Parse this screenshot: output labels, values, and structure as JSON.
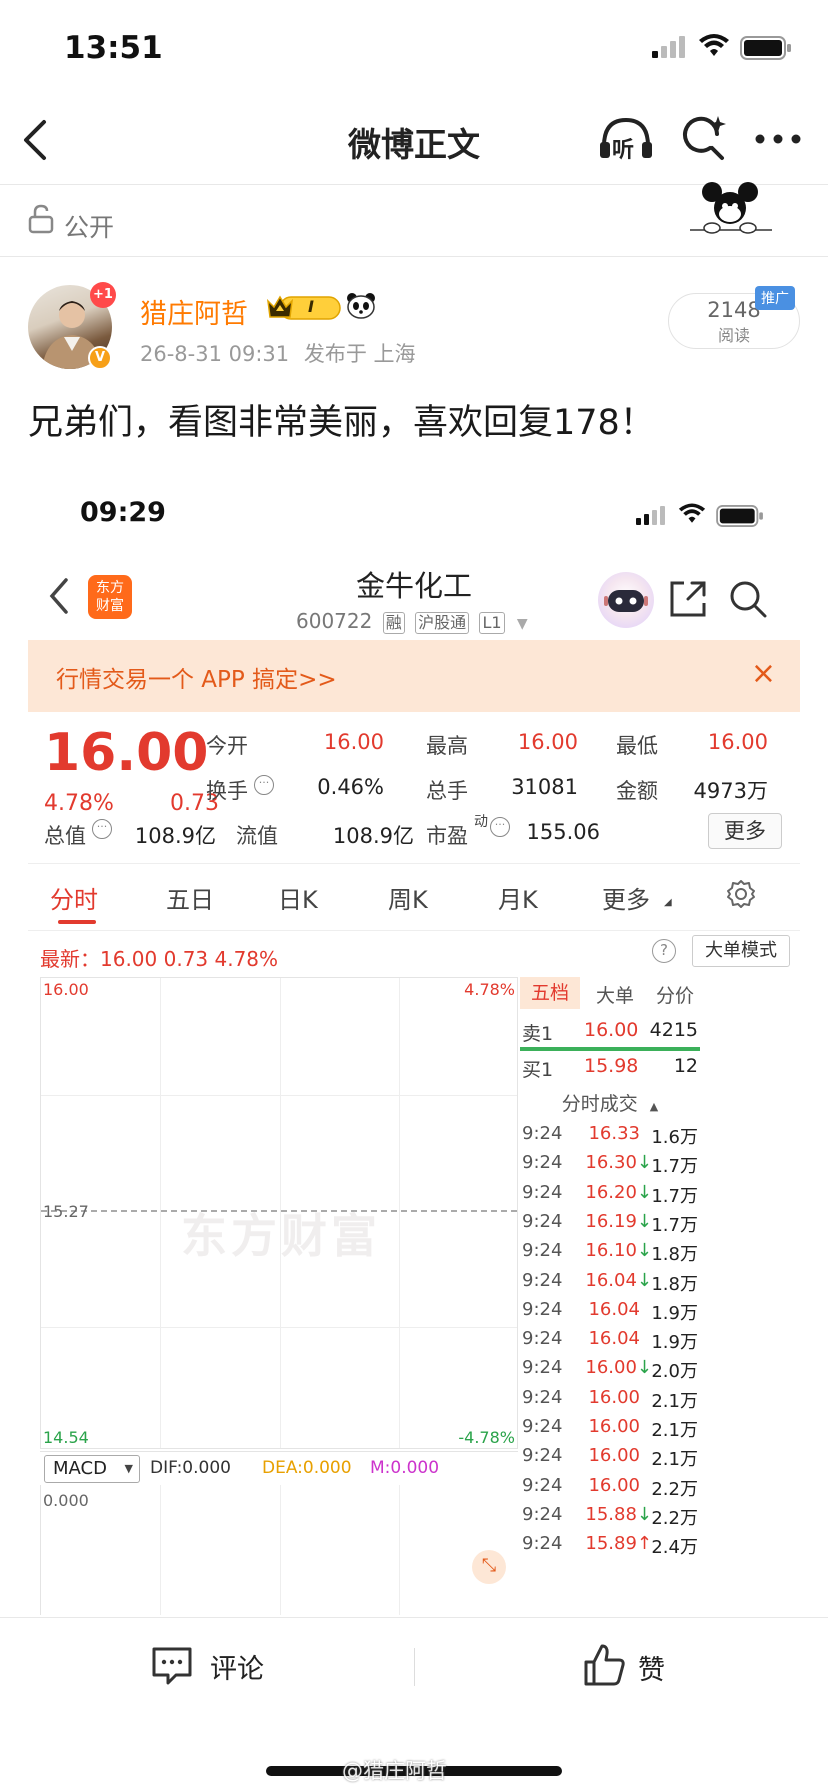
{
  "status_bar": {
    "time": "13:51"
  },
  "nav": {
    "title": "微博正文",
    "listen_label": "听"
  },
  "visibility": {
    "label": "公开"
  },
  "post": {
    "author": "猎庄阿哲",
    "avatar_badge": "+1",
    "level_badge": "I",
    "date": "26-8-31 09:31",
    "location_text": "发布于 上海",
    "read_count": "2148",
    "read_label": "阅读",
    "promo_tag": "推广",
    "text": "兄弟们，看图非常美丽，喜欢回复178！"
  },
  "screenshot": {
    "time": "09:29",
    "logo_text": [
      "东方",
      "财富"
    ],
    "stock_name": "金牛化工",
    "stock_code": "600722",
    "stock_tags": [
      "融",
      "沪股通",
      "L1"
    ],
    "banner_text": "行情交易一个 APP 搞定>>",
    "banner_close": "×",
    "price": "16.00",
    "change_pct": "4.78%",
    "change_abs": "0.73",
    "stats": [
      {
        "label": "今开",
        "value": "16.00",
        "color": "red"
      },
      {
        "label": "最高",
        "value": "16.00",
        "color": "red"
      },
      {
        "label": "最低",
        "value": "16.00",
        "color": "red"
      },
      {
        "label": "换手",
        "value": "0.46%",
        "color": "dark"
      },
      {
        "label": "总手",
        "value": "31081",
        "color": "dark"
      },
      {
        "label": "金额",
        "value": "4973万",
        "color": "dark"
      },
      {
        "label": "总值",
        "value": "108.9亿",
        "color": "dark"
      },
      {
        "label": "流值",
        "value": "108.9亿",
        "color": "dark"
      },
      {
        "label": "市盈",
        "value": "155.06",
        "color": "dark"
      }
    ],
    "pe_superscript": "动",
    "more_button": "更多",
    "tabs": [
      "分时",
      "五日",
      "日K",
      "周K",
      "月K",
      "更多"
    ],
    "latest_line": "最新：16.00  0.73  4.78%",
    "big_mode": "大单模式",
    "help": "?",
    "chart_labels": {
      "top_left": "16.00",
      "top_right": "4.78%",
      "mid": "15.27",
      "bottom_left": "14.54",
      "bottom_right": "-4.78%",
      "watermark": "东方财富"
    },
    "macd": {
      "select": "MACD",
      "dif": "DIF:0.000",
      "dea": "DEA:0.000",
      "m": "M:0.000",
      "zero": "0.000"
    },
    "right_panel": {
      "tabs": [
        "五档",
        "大单",
        "分价"
      ],
      "sell1": {
        "label": "卖1",
        "price": "16.00",
        "vol": "4215"
      },
      "buy1": {
        "label": "买1",
        "price": "15.98",
        "vol": "12"
      },
      "trades_header": "分时成交",
      "trades": [
        {
          "t": "9:24",
          "p": "16.33",
          "arrow": "",
          "v": "1.6万"
        },
        {
          "t": "9:24",
          "p": "16.30",
          "arrow": "down",
          "v": "1.7万"
        },
        {
          "t": "9:24",
          "p": "16.20",
          "arrow": "down",
          "v": "1.7万"
        },
        {
          "t": "9:24",
          "p": "16.19",
          "arrow": "down",
          "v": "1.7万"
        },
        {
          "t": "9:24",
          "p": "16.10",
          "arrow": "down",
          "v": "1.8万"
        },
        {
          "t": "9:24",
          "p": "16.04",
          "arrow": "down",
          "v": "1.8万"
        },
        {
          "t": "9:24",
          "p": "16.04",
          "arrow": "",
          "v": "1.9万"
        },
        {
          "t": "9:24",
          "p": "16.04",
          "arrow": "",
          "v": "1.9万"
        },
        {
          "t": "9:24",
          "p": "16.00",
          "arrow": "down",
          "v": "2.0万"
        },
        {
          "t": "9:24",
          "p": "16.00",
          "arrow": "",
          "v": "2.1万"
        },
        {
          "t": "9:24",
          "p": "16.00",
          "arrow": "",
          "v": "2.1万"
        },
        {
          "t": "9:24",
          "p": "16.00",
          "arrow": "",
          "v": "2.1万"
        },
        {
          "t": "9:24",
          "p": "16.00",
          "arrow": "",
          "v": "2.2万"
        },
        {
          "t": "9:24",
          "p": "15.88",
          "arrow": "down",
          "v": "2.2万"
        },
        {
          "t": "9:24",
          "p": "15.89",
          "arrow": "up",
          "v": "2.4万"
        }
      ]
    }
  },
  "bottom": {
    "comment": "评论",
    "like": "赞"
  },
  "watermark": "@猎庄阿哲",
  "colors": {
    "red": "#e23a2e",
    "green": "#2aa34a",
    "orange": "#ff7a00"
  }
}
